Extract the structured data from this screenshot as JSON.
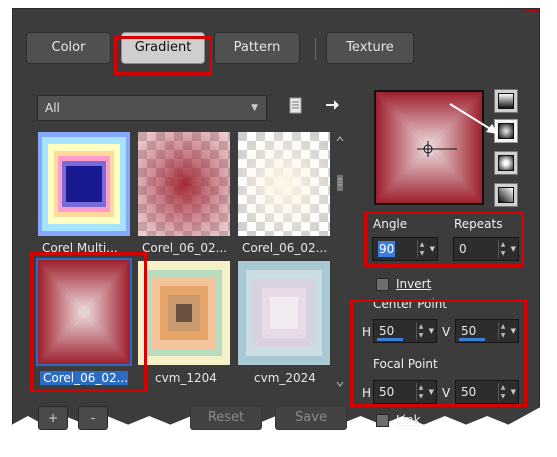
{
  "tabs": {
    "color": "Color",
    "gradient": "Gradient",
    "pattern": "Pattern",
    "texture": "Texture"
  },
  "category_dropdown": {
    "value": "All"
  },
  "toolbar_icons": [
    "page-icon",
    "arrow-right-icon"
  ],
  "thumbnails": [
    {
      "label": "Corel Multi..."
    },
    {
      "label": "Corel_06_02..."
    },
    {
      "label": "Corel_06_02..."
    },
    {
      "label": "Corel_06_02..."
    },
    {
      "label": "cvm_1204"
    },
    {
      "label": "cvm_2024"
    }
  ],
  "bottom_buttons": {
    "add": "+",
    "remove": "-",
    "reset": "Reset",
    "save": "Save"
  },
  "angle": {
    "label": "Angle",
    "value": "90"
  },
  "repeats": {
    "label": "Repeats",
    "value": "0"
  },
  "invert": {
    "label": "Invert",
    "checked": false
  },
  "center_point": {
    "label": "Center Point",
    "h_label": "H",
    "h_value": "50",
    "v_label": "V",
    "v_value": "50"
  },
  "focal_point": {
    "label": "Focal Point",
    "h_label": "H",
    "h_value": "50",
    "v_label": "V",
    "v_value": "50"
  },
  "link": {
    "label": "Link",
    "checked": false
  },
  "gradient_styles": [
    "linear-style-icon",
    "rectangular-style-icon",
    "sunburst-style-icon",
    "radial-style-icon"
  ],
  "colors": {
    "accent_red": "#d60000",
    "gradient_dark_red": "#9e1f2e",
    "gradient_light": "#efe0e0",
    "selection_blue": "#2b6cc4"
  }
}
